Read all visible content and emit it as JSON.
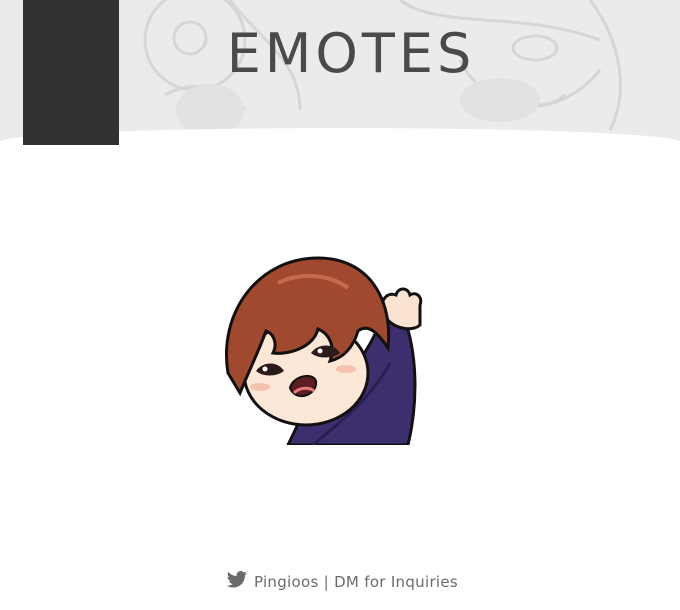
{
  "header": {
    "title": "EMOTES"
  },
  "emote": {
    "character": "waving-chibi-emote"
  },
  "footer": {
    "icon": "twitter-bird-icon",
    "credit": "Pingioos | DM for Inquiries"
  },
  "colors": {
    "header_background": "#ebebeb",
    "corner_block": "#333231",
    "title_text": "#4a4a4a",
    "footer_text": "#6b6b6b",
    "hair": "#a0492f",
    "sweater": "#3d2f6e"
  }
}
